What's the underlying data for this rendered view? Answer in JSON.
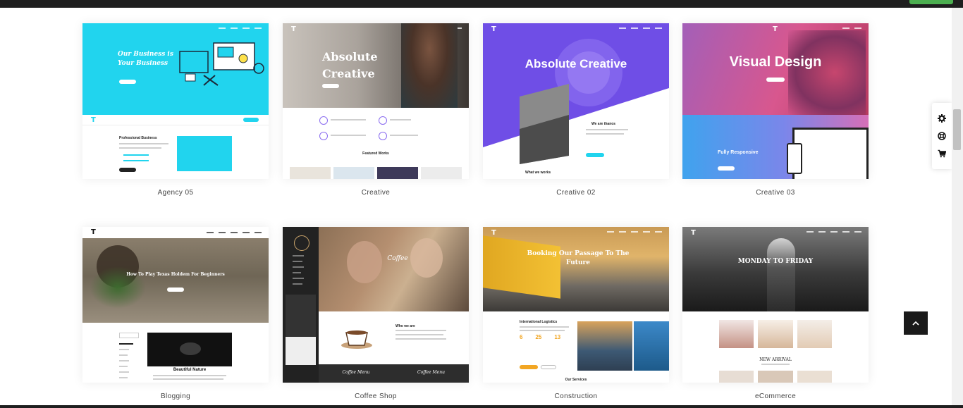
{
  "demos": [
    {
      "name": "Agency 05",
      "hero_title": "Our Business is Your Business",
      "section_title": "Professional Business"
    },
    {
      "name": "Creative",
      "hero_title": "Absolute Creative",
      "section_title": "Featured Works"
    },
    {
      "name": "Creative 02",
      "hero_title": "Absolute Creative",
      "section_title": "We are thanos",
      "footer_title": "What we works"
    },
    {
      "name": "Creative 03",
      "hero_title": "Visual Design",
      "section_title": "Fully Responsive"
    },
    {
      "name": "Blogging",
      "hero_title": "How To Play Texas Holdem For Beginners",
      "section_title": "Beautiful Nature"
    },
    {
      "name": "Coffee Shop",
      "hero_title": "Coffee",
      "section_title": "Who we are",
      "tab1": "Coffee Menu",
      "tab2": "Coffee Menu"
    },
    {
      "name": "Construction",
      "hero_title": "Booking Our Passage To The Future",
      "section_title": "International Logistics",
      "stats": [
        "6",
        "25",
        "13"
      ],
      "footer_title": "Our Services"
    },
    {
      "name": "eCommerce",
      "hero_title": "MONDAY TO FRIDAY",
      "section_title": "NEW ARRIVAL"
    }
  ],
  "colors": {
    "cyan": "#21d4ee",
    "purple": "#6f4ee6",
    "pink": "#e84aa7",
    "dark": "#1f1f1f",
    "accent_green": "#4caf50"
  },
  "icons": {
    "settings": "gear-icon",
    "support": "lifebuoy-icon",
    "cart": "cart-icon",
    "back_to_top": "chevron-up-icon"
  }
}
